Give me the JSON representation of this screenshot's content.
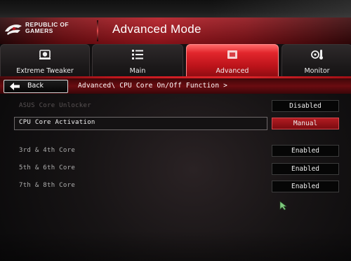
{
  "header": {
    "brand_line1": "REPUBLIC OF",
    "brand_line2": "GAMERS",
    "title": "Advanced Mode",
    "logo_icon": "rog-eye-icon"
  },
  "tabs": [
    {
      "label": "Extreme Tweaker",
      "icon": "cpu-fan-icon",
      "active": false
    },
    {
      "label": "Main",
      "icon": "list-icon",
      "active": false
    },
    {
      "label": "Advanced",
      "icon": "chip-icon",
      "active": true
    },
    {
      "label": "Monitor",
      "icon": "thermometer-fan-icon",
      "active": false
    }
  ],
  "nav": {
    "back_label": "Back",
    "breadcrumb": "Advanced\\ CPU Core On/Off Function >"
  },
  "settings": [
    {
      "label": "ASUS Core Unlocker",
      "value": "Disabled",
      "dimmed": true
    },
    {
      "label": "CPU Core Activation",
      "value": "Manual",
      "highlighted": true
    },
    {
      "label": "3rd & 4th Core",
      "value": "Enabled"
    },
    {
      "label": "5th & 6th Core",
      "value": "Enabled"
    },
    {
      "label": "7th & 8th Core",
      "value": "Enabled"
    }
  ],
  "colors": {
    "accent_red": "#c1161d",
    "selected_value": "#b31c22",
    "background": "#171415"
  }
}
